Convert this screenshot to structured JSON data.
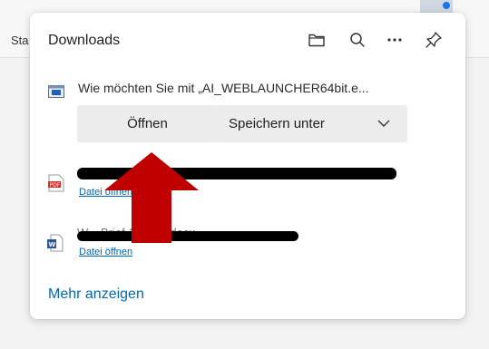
{
  "browser": {
    "tab_partial_label": "Sta"
  },
  "panel": {
    "title": "Downloads",
    "icons": [
      "folder-icon",
      "search-icon",
      "more-icon",
      "pin-icon"
    ]
  },
  "prompt": {
    "text": "Wie möchten Sie mit „AI_WEBLAUNCHER64bit.e...",
    "open_label": "Öffnen",
    "save_label": "Speichern unter"
  },
  "items": [
    {
      "type_badge": "PDF",
      "link": "Datei öffnen"
    },
    {
      "type_badge": "W",
      "name_visible": "W... Brief 113021.docx",
      "link": "Datei öffnen"
    }
  ],
  "footer": {
    "more_label": "Mehr anzeigen"
  },
  "colors": {
    "link": "#0067b8",
    "arrow": "#c00000",
    "button_bg": "#ececec"
  }
}
